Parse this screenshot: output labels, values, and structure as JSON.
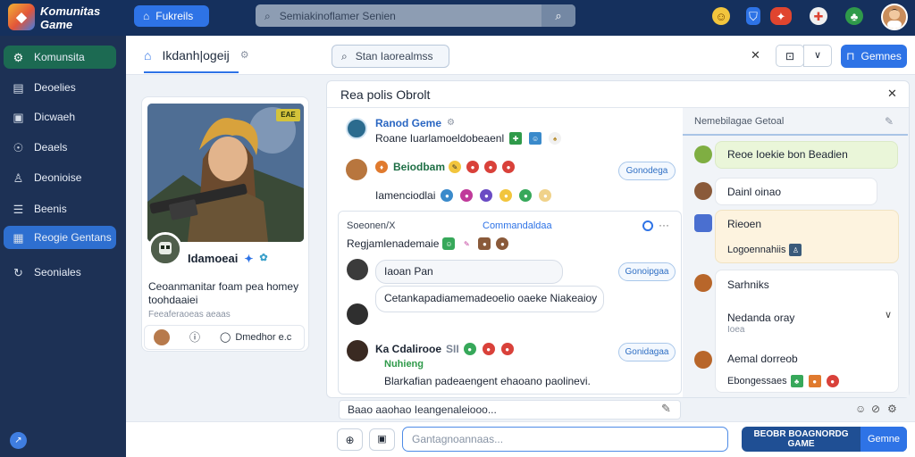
{
  "topbar": {
    "logo_line1": "Komunitas",
    "logo_line2": "Game",
    "home_label": "Fukreils",
    "search_placeholder": "Semiakinoflamer Senien",
    "right_icons": [
      "emoji-icon",
      "shield-icon",
      "controller-icon",
      "bell-icon",
      "user-plus-icon"
    ]
  },
  "sidebar": {
    "items": [
      {
        "label": "Komunsita",
        "icon": "gear-icon",
        "state": "active"
      },
      {
        "label": "Deoelies",
        "icon": "document-icon",
        "state": ""
      },
      {
        "label": "Dicwaeh",
        "icon": "image-icon",
        "state": ""
      },
      {
        "label": "Deaels",
        "icon": "users-icon",
        "state": ""
      },
      {
        "label": "Deonioise",
        "icon": "user-icon",
        "state": ""
      },
      {
        "label": "Beenis",
        "icon": "list-icon",
        "state": ""
      },
      {
        "label": "Reogie Gentans",
        "icon": "grid-icon",
        "state": "selected"
      },
      {
        "label": "Seoniales",
        "icon": "refresh-icon",
        "state": ""
      }
    ]
  },
  "header": {
    "tab_label": "Ikdanh|ogeij",
    "search_label": "Stan Iaorealmss",
    "share_label": "Gemnes"
  },
  "profile": {
    "hero_badge": "EAE",
    "name": "Idamoeai",
    "bio": "Ceoanmanitar foam pea homey toohdaaiei",
    "meta": "Feeaferaoeas aeaas",
    "action_label": "Dmedhor e.c"
  },
  "chat": {
    "title": "Rea polis Obrolt",
    "messages": [
      {
        "name": "Ranod Geme",
        "text": "Roane Iuarlamoeldobeaenl",
        "name_color": "#2a66c2"
      },
      {
        "name": "Beiodbam",
        "text": "Iamenciodlai",
        "name_color": "#1e6f45",
        "button": "Gonodega"
      }
    ],
    "thread": {
      "title": "Soeonen/X",
      "link": "Commandaldaa",
      "subline": "Regjamlenademaie",
      "bubble1": "Iaoan Pan",
      "bubble1_button": "Gonoipgaa",
      "bubble2": "Cetankapadiamemadeoelio oaeke Niakeaioy",
      "reply_name": "Ka Cdalirooe",
      "reply_tag": "Nuhieng",
      "reply_score": "SII",
      "reply_button": "Gonidagaa",
      "reply_text": "Blarkafian padeaengent ehaoano paolinevi."
    },
    "reply_bar": "Baao aaohao Ieangenaleiooo..."
  },
  "right_panel": {
    "header": "Nemebilagae Getoal",
    "cards": [
      {
        "text": "Reoe Ioekie bon Beadien"
      },
      {
        "text": "Dainl oinao"
      },
      {
        "text": "Rieoen",
        "sub": "Logoennahiis"
      },
      {
        "text": "Sarhniks",
        "row2": "Nedanda oray",
        "row2_sub": "Ioea",
        "row3": "Aemal dorreob",
        "row3_sub": "Ebongessaes"
      }
    ]
  },
  "composer": {
    "placeholder": "Gantagnoannaas...",
    "send_main": "BEOBR BOAGNORDG GAME",
    "send_alt": "Gemne"
  }
}
